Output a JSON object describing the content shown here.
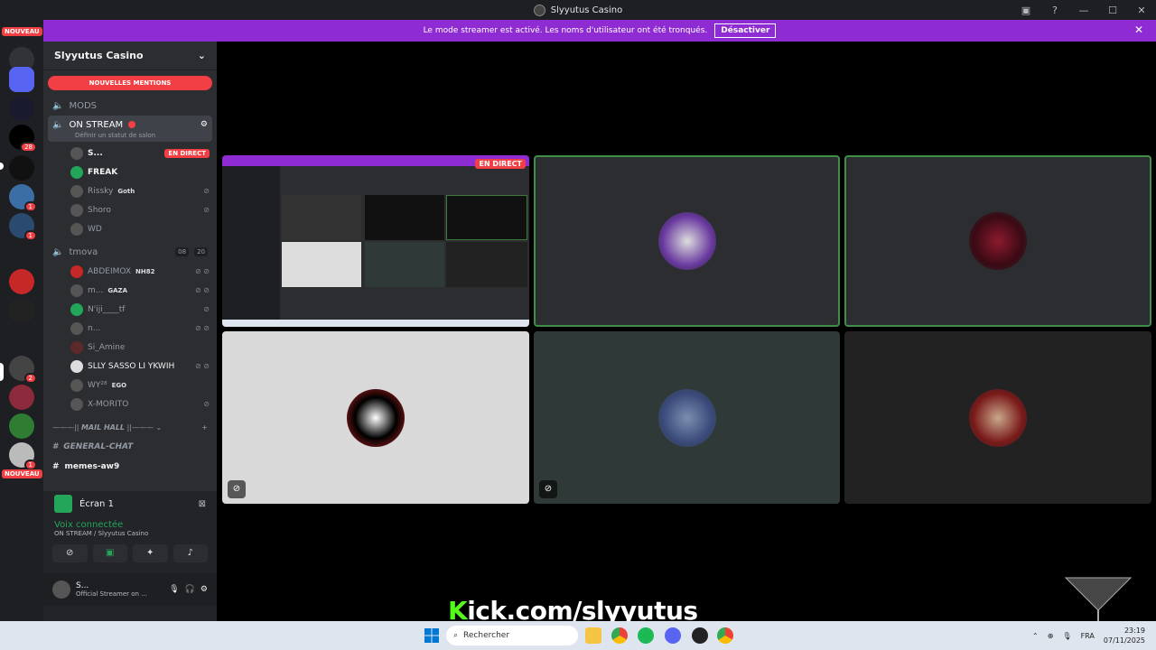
{
  "window": {
    "title": "Slyyutus Casino",
    "controls": [
      "—",
      "☐",
      "✕"
    ]
  },
  "banner": {
    "text": "Le mode streamer est activé. Les noms d'utilisateur ont été tronqués.",
    "button": "Désactiver"
  },
  "servers": {
    "new_label": "NOUVEAU",
    "badges": [
      "28",
      "1",
      "1",
      "2",
      "1"
    ]
  },
  "sidebar": {
    "guild_name": "Slyyutus Casino",
    "mentions": "NOUVELLES MENTIONS",
    "channels": {
      "mods": "MODS",
      "on_stream": "ON STREAM",
      "on_stream_status": "Définir un statut de salon",
      "tmova": "tmova",
      "tmova_counts": [
        "08",
        "20"
      ]
    },
    "on_stream_members": [
      {
        "name": "S...",
        "badge": "EN DIRECT"
      },
      {
        "name": "FREAK",
        "tag": ""
      },
      {
        "name": "Rissky",
        "tag": "Goth"
      },
      {
        "name": "Shoro",
        "tag": ""
      },
      {
        "name": "WD",
        "tag": ""
      }
    ],
    "tmova_members": [
      {
        "name": "ABDEIMOX",
        "tag": "NH82"
      },
      {
        "name": "m...",
        "tag": "GAZA"
      },
      {
        "name": "N'iji____tf",
        "tag": ""
      },
      {
        "name": "n...",
        "tag": ""
      },
      {
        "name": "Si_Amine",
        "tag": ""
      },
      {
        "name": "SLLY SASSO LI YKWIH",
        "tag": ""
      },
      {
        "name": "WY²⁸",
        "tag": "EGO"
      },
      {
        "name": "X-MORITO",
        "tag": ""
      }
    ],
    "category": "MAIL HALL",
    "text_channels": [
      "GENERAL-CHAT",
      "memes-aw9"
    ]
  },
  "panel": {
    "screen_label": "Écran 1",
    "voice_status": "Voix connectée",
    "voice_sub": "ON STREAM / Slyyutus Casino",
    "user_name": "S...",
    "user_status": "Official Streamer on ..."
  },
  "stage": {
    "live_label": "EN DIRECT"
  },
  "overlay": {
    "kick_k": "K",
    "kick_rest": "ick.com/slyyutus"
  },
  "taskbar": {
    "search": "Rechercher",
    "lang": "FRA",
    "time": "23:19",
    "date": "07/11/2025"
  },
  "colors": {
    "accent_green": "#23a55a",
    "live_red": "#f23f43",
    "banner_purple": "#8e2bd3",
    "kick_green": "#53fc18"
  }
}
